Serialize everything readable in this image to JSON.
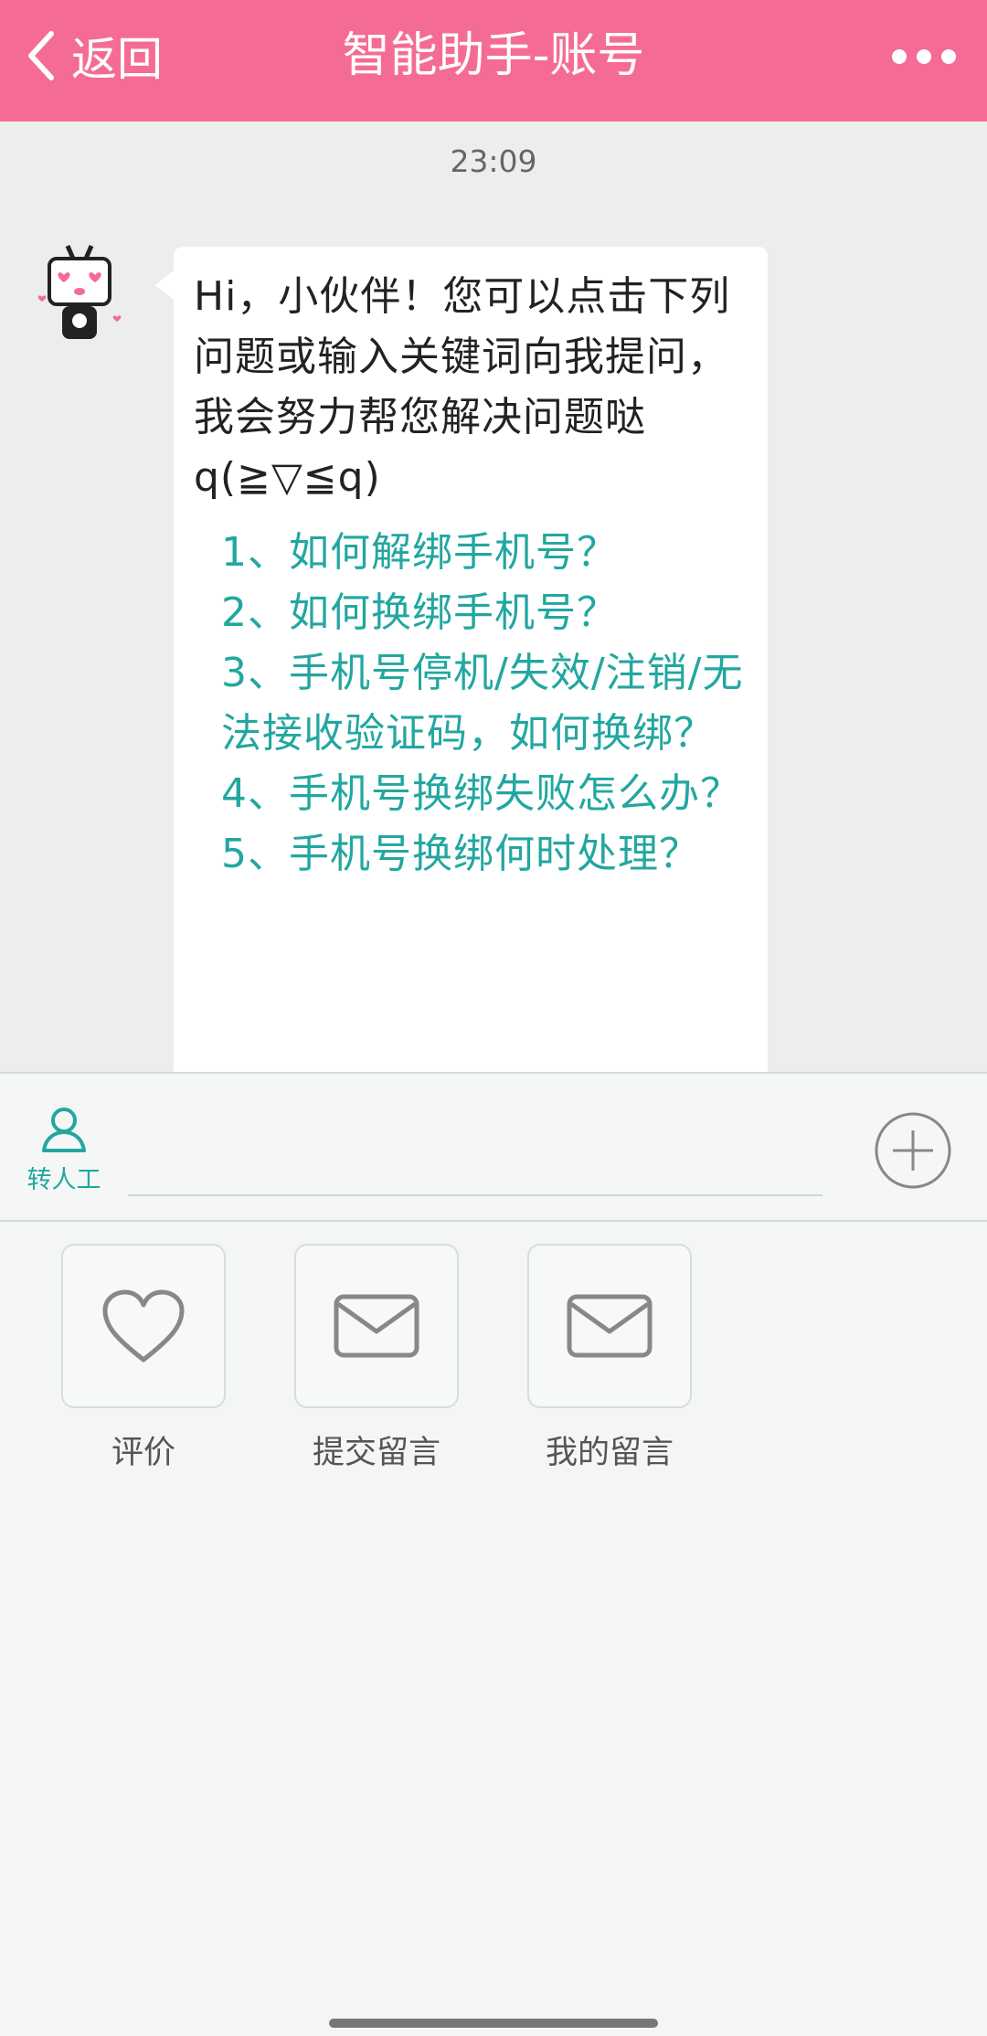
{
  "header": {
    "back_label": "返回",
    "title": "智能助手-账号",
    "back_icon": "chevron-left-icon",
    "more_icon": "more-dots-icon",
    "background": "#f46c95"
  },
  "chat": {
    "timestamp": "23:09",
    "bot_message": {
      "greeting": "Hi，小伙伴！您可以点击下列问题或输入关键词向我提问，我会努力帮您解决问题哒q(≧▽≦q)",
      "questions": [
        "1、如何解绑手机号？",
        "2、如何换绑手机号？",
        "3、手机号停机/失效/注销/无法接收验证码，如何换绑？",
        "4、手机号换绑失败怎么办？",
        "5、手机号换绑何时处理？"
      ]
    }
  },
  "inputbar": {
    "human_label": "转人工",
    "human_icon": "person-icon",
    "input_value": "",
    "plus_icon": "plus-circle-icon"
  },
  "actions": [
    {
      "label": "评价",
      "icon": "heart-icon"
    },
    {
      "label": "提交留言",
      "icon": "envelope-icon"
    },
    {
      "label": "我的留言",
      "icon": "envelope-icon"
    }
  ],
  "colors": {
    "accent": "#f46c95",
    "link": "#22a7a0"
  }
}
